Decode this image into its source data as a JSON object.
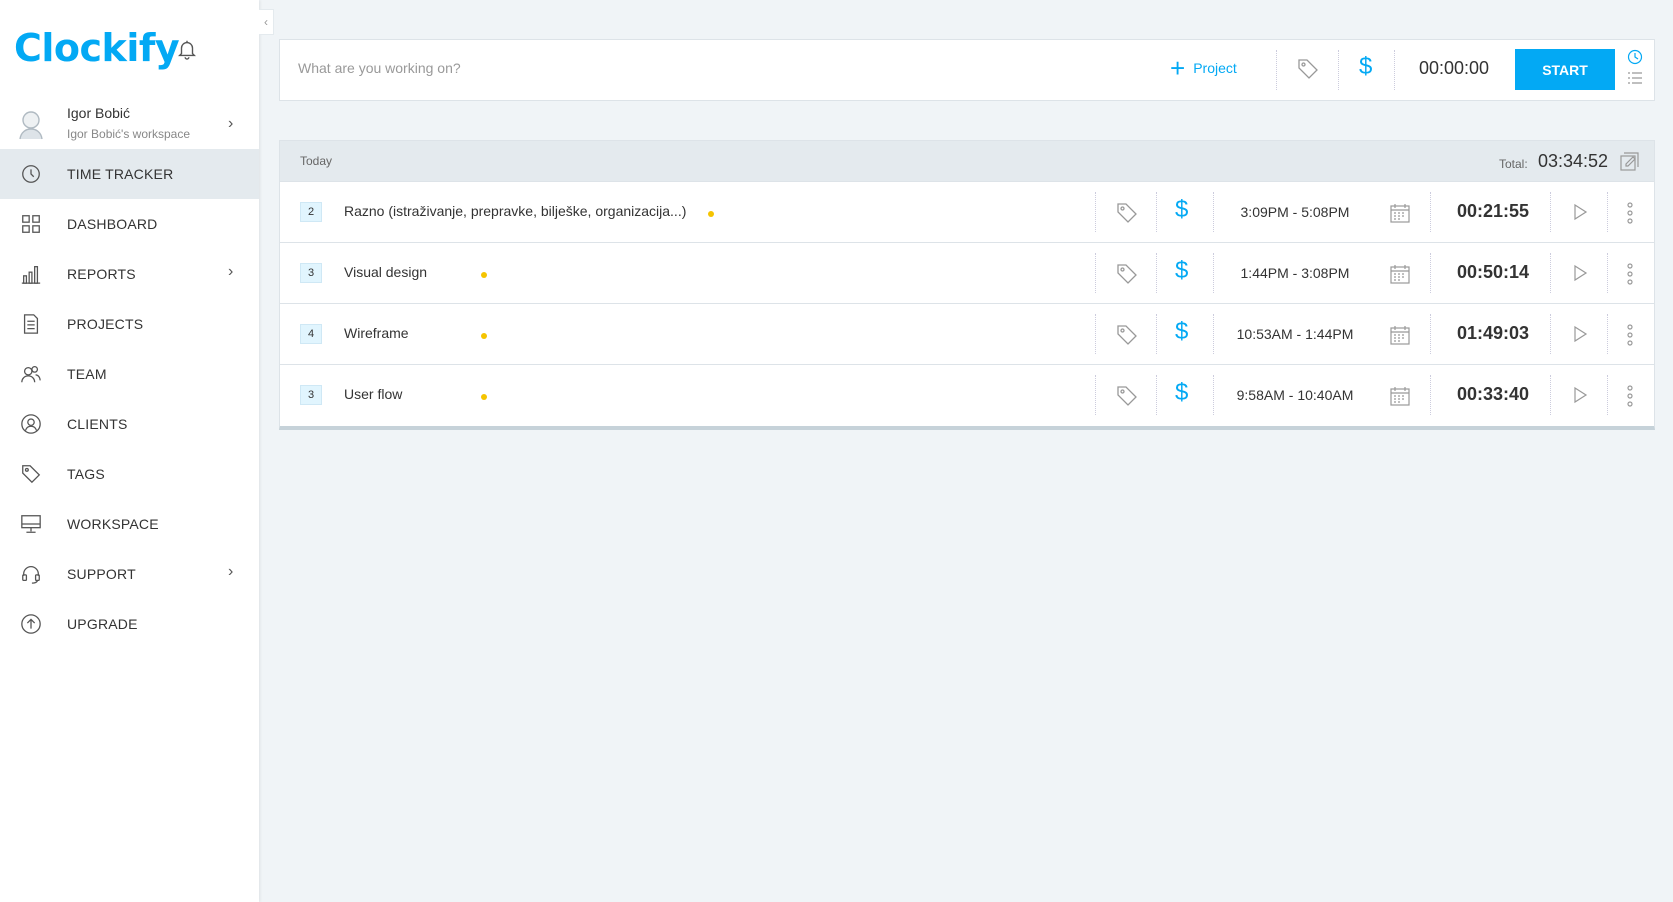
{
  "sidebar": {
    "logo": "Clockify",
    "collapse_glyph": "‹",
    "user": {
      "name": "Igor Bobić",
      "workspace": "Igor Bobić's workspace"
    },
    "items": [
      {
        "label": "TIME TRACKER",
        "icon": "clock-icon",
        "active": true
      },
      {
        "label": "DASHBOARD",
        "icon": "grid-icon"
      },
      {
        "label": "REPORTS",
        "icon": "bar-chart-icon",
        "chevron": true
      },
      {
        "label": "PROJECTS",
        "icon": "document-icon"
      },
      {
        "label": "TEAM",
        "icon": "team-icon"
      },
      {
        "label": "CLIENTS",
        "icon": "client-icon"
      },
      {
        "label": "TAGS",
        "icon": "tag-icon"
      },
      {
        "label": "WORKSPACE",
        "icon": "monitor-icon"
      },
      {
        "label": "SUPPORT",
        "icon": "headset-icon",
        "chevron": true
      },
      {
        "label": "UPGRADE",
        "icon": "upload-circle-icon"
      }
    ]
  },
  "timer": {
    "placeholder": "What are you working on?",
    "project_label": "Project",
    "currency_symbol": "$",
    "time": "00:00:00",
    "start_label": "START"
  },
  "day": {
    "label": "Today",
    "total_label": "Total:",
    "total": "03:34:52",
    "entries": [
      {
        "count": "2",
        "description": "Razno (istraživanje, prepravke, bilješke, organizacija...)",
        "start": "3:09PM",
        "end": "5:08PM",
        "duration": "00:21:55"
      },
      {
        "count": "3",
        "description": "Visual design",
        "start": "1:44PM",
        "end": "3:08PM",
        "duration": "00:50:14"
      },
      {
        "count": "4",
        "description": "Wireframe",
        "start": "10:53AM",
        "end": "1:44PM",
        "duration": "01:49:03"
      },
      {
        "count": "3",
        "description": "User flow",
        "start": "9:58AM",
        "end": "10:40AM",
        "duration": "00:33:40"
      }
    ]
  },
  "colors": {
    "accent": "#03a9f4",
    "project_dot": "#f5c400",
    "background": "#f0f4f7"
  }
}
